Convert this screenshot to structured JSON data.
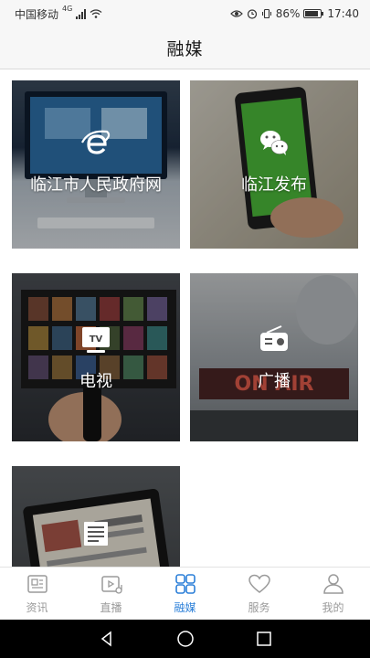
{
  "status_bar": {
    "carrier": "中国移动",
    "network": "4G",
    "battery": "86%",
    "time": "17:40"
  },
  "header": {
    "title": "融媒"
  },
  "tiles": [
    {
      "label": "临江市人民政府网",
      "icon": "ie-browser-icon"
    },
    {
      "label": "临江发布",
      "icon": "wechat-icon"
    },
    {
      "label": "电视",
      "icon": "tv-icon"
    },
    {
      "label": "广播",
      "icon": "radio-icon"
    },
    {
      "label": "",
      "icon": "newspaper-icon"
    }
  ],
  "tab_bar": {
    "items": [
      {
        "label": "资讯",
        "icon": "news-icon"
      },
      {
        "label": "直播",
        "icon": "live-icon"
      },
      {
        "label": "融媒",
        "icon": "grid-icon",
        "active": true
      },
      {
        "label": "服务",
        "icon": "heart-icon"
      },
      {
        "label": "我的",
        "icon": "user-icon"
      }
    ]
  },
  "colors": {
    "accent": "#2b7fd8",
    "tab_inactive": "#9a9a9a"
  }
}
